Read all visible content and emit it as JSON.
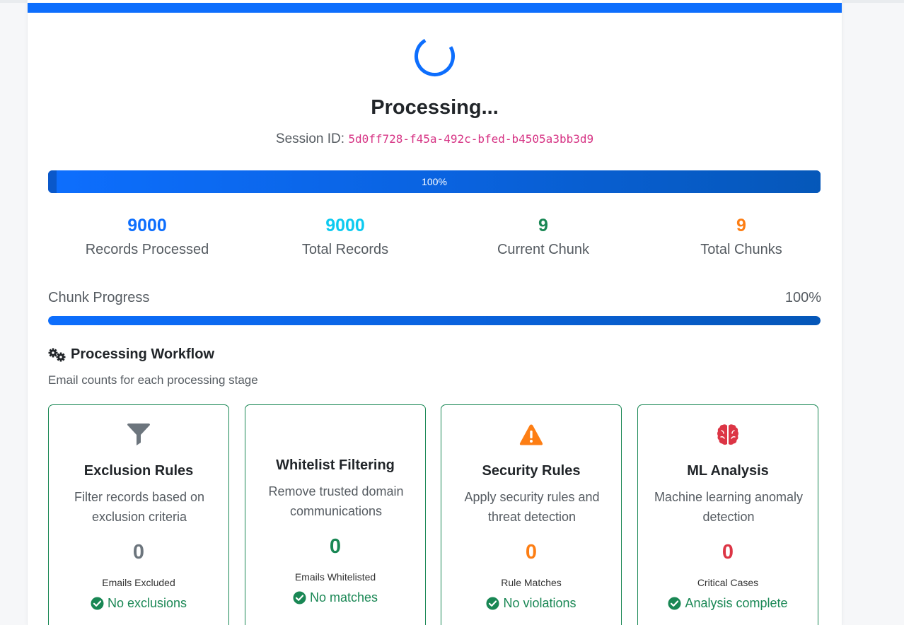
{
  "header": {
    "title": "Processing...",
    "session_label": "Session ID:",
    "session_id": "5d0ff728-f45a-492c-bfed-b4505a3bb3d9"
  },
  "overall_progress": {
    "percent": 100,
    "label": "100%"
  },
  "stats": [
    {
      "value": "9000",
      "label": "Records Processed",
      "color": "#0d6efd"
    },
    {
      "value": "9000",
      "label": "Total Records",
      "color": "#0dcaf0"
    },
    {
      "value": "9",
      "label": "Current Chunk",
      "color": "#198754"
    },
    {
      "value": "9",
      "label": "Total Chunks",
      "color": "#fd7e14"
    }
  ],
  "chunk_progress": {
    "label": "Chunk Progress",
    "percent": 100,
    "percent_label": "100%"
  },
  "workflow": {
    "title": "Processing Workflow",
    "subtitle": "Email counts for each processing stage",
    "icon": "gears-icon",
    "stages": [
      {
        "icon": "filter-icon",
        "title": "Exclusion Rules",
        "description": "Filter records based on exclusion criteria",
        "count": "0",
        "count_color": "#6c757d",
        "count_label": "Emails Excluded",
        "status": "No exclusions"
      },
      {
        "icon": "none",
        "title": "Whitelist Filtering",
        "description": "Remove trusted domain communications",
        "count": "0",
        "count_color": "#198754",
        "count_label": "Emails Whitelisted",
        "status": "No matches"
      },
      {
        "icon": "warning-icon",
        "title": "Security Rules",
        "description": "Apply security rules and threat detection",
        "count": "0",
        "count_color": "#fd7e14",
        "count_label": "Rule Matches",
        "status": "No violations"
      },
      {
        "icon": "brain-icon",
        "title": "ML Analysis",
        "description": "Machine learning anomaly detection",
        "count": "0",
        "count_color": "#dc3545",
        "count_label": "Critical Cases",
        "status": "Analysis complete"
      }
    ]
  },
  "colors": {
    "primary": "#0d6efd",
    "success": "#198754",
    "warning": "#fd7e14",
    "danger": "#dc3545",
    "session_id": "#d63384"
  }
}
